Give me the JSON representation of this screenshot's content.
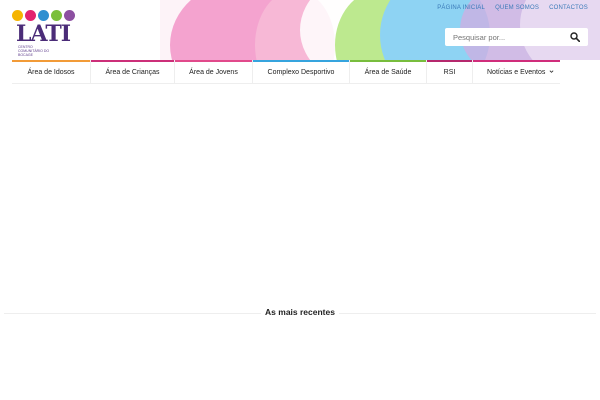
{
  "brand": {
    "logo_text": "LATI",
    "logo_subtitle": "CENTRO COMUNITÁRIO DO BOCAGE",
    "dot_colors": [
      "#f5b400",
      "#e2236f",
      "#2f8fd0",
      "#7bbf3a",
      "#8c4fa1"
    ]
  },
  "top_links": [
    {
      "label": "PÁGINA INICIAL"
    },
    {
      "label": "QUEM SOMOS"
    },
    {
      "label": "CONTACTOS"
    }
  ],
  "search": {
    "placeholder": "Pesquisar por..."
  },
  "nav": {
    "items": [
      {
        "label": "Área de Idosos",
        "bar_color": "#f29b38"
      },
      {
        "label": "Área de Crianças",
        "bar_color": "#cc2f79"
      },
      {
        "label": "Área de Jovens",
        "bar_color": "#e14a8b"
      },
      {
        "label": "Complexo Desportivo",
        "bar_color": "#36a4de"
      },
      {
        "label": "Área de Saúde",
        "bar_color": "#78bd3d"
      },
      {
        "label": "RSI",
        "bar_color": "#b5286d"
      },
      {
        "label": "Notícias e Eventos",
        "bar_color": "#d02d7b",
        "has_dropdown": true
      }
    ]
  },
  "section": {
    "title": "As mais recentes"
  }
}
